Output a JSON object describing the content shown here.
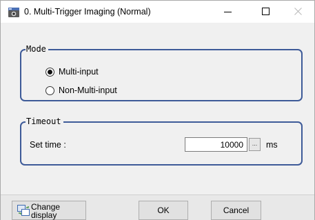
{
  "window": {
    "title": "0. Multi-Trigger Imaging (Normal)",
    "controls": {
      "minimize_icon": "minimize-icon",
      "maximize_icon": "maximize-icon",
      "close_icon": "close-icon"
    }
  },
  "mode": {
    "legend": "Mode",
    "options": [
      {
        "label": "Multi-input",
        "selected": true
      },
      {
        "label": "Non-Multi-input",
        "selected": false
      }
    ]
  },
  "timeout": {
    "legend": "Timeout",
    "set_time_label": "Set time :",
    "value": "10000",
    "ellipsis_label": "...",
    "unit": "ms"
  },
  "buttons": {
    "change_display": "Change\ndisplay",
    "ok": "OK",
    "cancel": "Cancel"
  },
  "colors": {
    "group_border": "#3d5a98",
    "dialog_bg": "#f0f0f0",
    "titlebar_bg": "#ffffff"
  }
}
